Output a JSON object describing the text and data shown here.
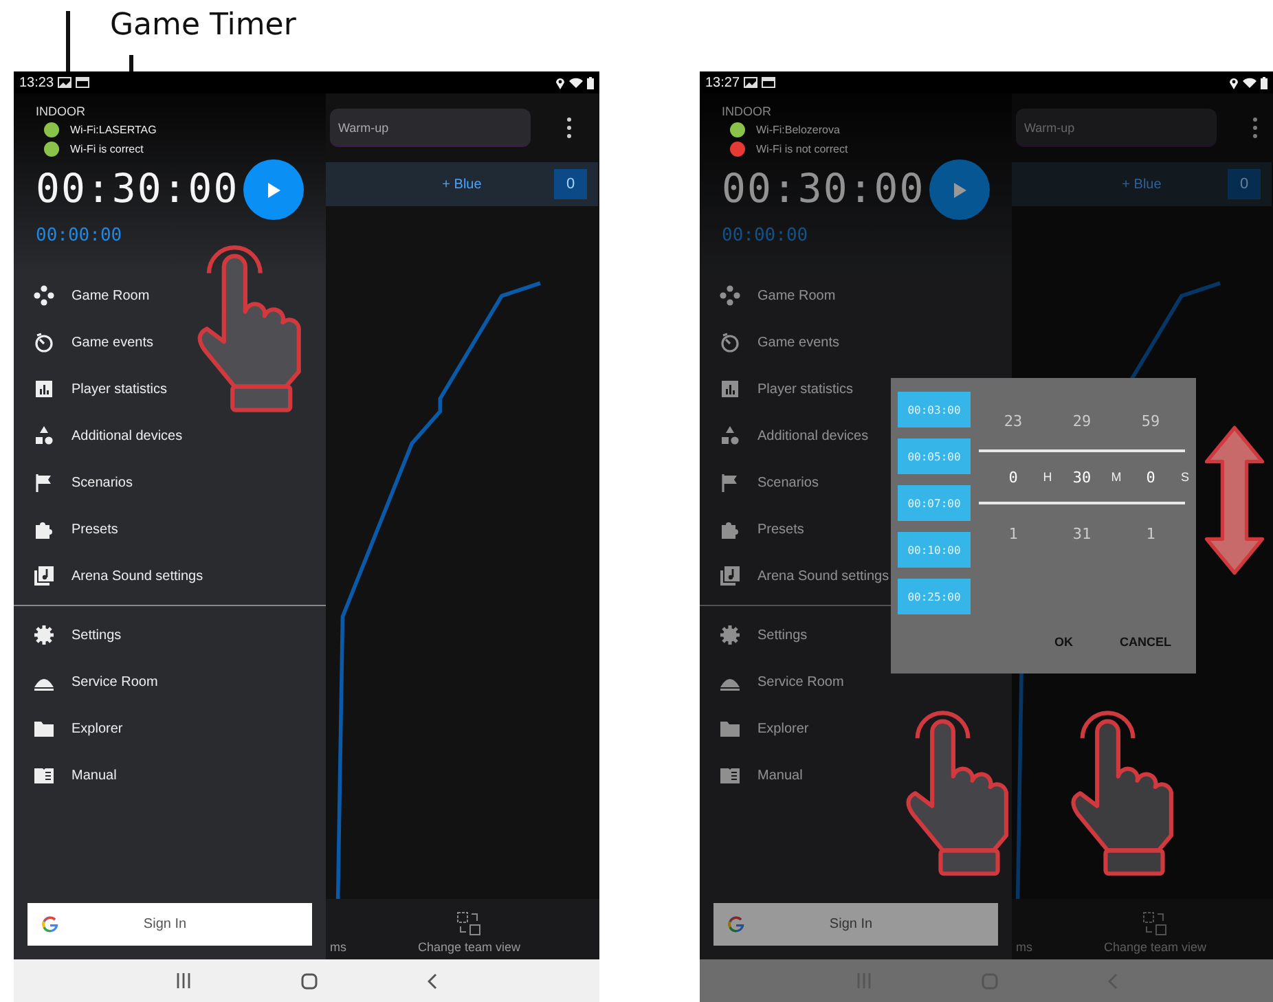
{
  "caption": {
    "title": "Game Timer"
  },
  "screens": [
    {
      "status_time": "13:23",
      "mode": "INDOOR",
      "wifi": [
        {
          "text": "Wi-Fi:LASERTAG",
          "color": "#8bc34a"
        },
        {
          "text": "Wi-Fi is correct",
          "color": "#8bc34a"
        }
      ],
      "game_timer": "00:30:00",
      "elapsed_timer": "00:00:00",
      "stage": "Warm-up",
      "team": "+ Blue",
      "team_score": "0",
      "menu": [
        "Game Room",
        "Game events",
        "Player statistics",
        "Additional devices",
        "Scenarios",
        "Presets",
        "Arena Sound settings"
      ],
      "footer_menu": [
        "Settings",
        "Service Room",
        "Explorer",
        "Manual"
      ],
      "sign_in": "Sign In",
      "bottom_actions": [
        "ms",
        "Change team view"
      ],
      "dimmed": false
    },
    {
      "status_time": "13:27",
      "mode": "INDOOR",
      "wifi": [
        {
          "text": "Wi-Fi:Belozerova",
          "color": "#8bc34a"
        },
        {
          "text": "Wi-Fi is not correct",
          "color": "#e53935"
        }
      ],
      "game_timer": "00:30:00",
      "elapsed_timer": "00:00:00",
      "stage": "Warm-up",
      "team": "+ Blue",
      "team_score": "0",
      "menu": [
        "Game Room",
        "Game events",
        "Player statistics",
        "Additional devices",
        "Scenarios",
        "Presets",
        "Arena Sound settings"
      ],
      "footer_menu": [
        "Settings",
        "Service Room",
        "Explorer",
        "Manual"
      ],
      "sign_in": "Sign In",
      "bottom_actions": [
        "ms",
        "Change team view"
      ],
      "dimmed": true,
      "dialog": {
        "presets": [
          "00:03:00",
          "00:05:00",
          "00:07:00",
          "00:10:00",
          "00:25:00"
        ],
        "columns": [
          {
            "above": "23",
            "value": "0",
            "below": "1",
            "unit": "H"
          },
          {
            "above": "29",
            "value": "30",
            "below": "31",
            "unit": "M"
          },
          {
            "above": "59",
            "value": "0",
            "below": "1",
            "unit": "S"
          }
        ],
        "buttons": [
          "OK",
          "CANCEL"
        ]
      }
    }
  ]
}
